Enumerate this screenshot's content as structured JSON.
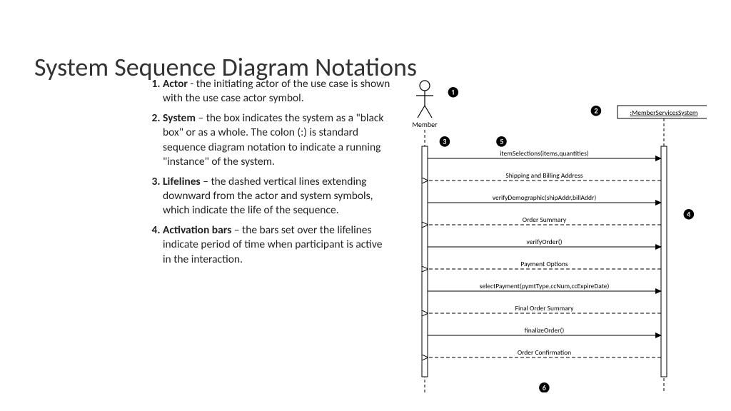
{
  "title": "System Sequence Diagram Notations",
  "list": [
    {
      "term": "Actor",
      "sep": " - ",
      "desc": "the initiating actor of the use case is shown with the use case actor symbol."
    },
    {
      "term": "System",
      "sep": " – ",
      "desc": "the box indicates the system as a \"black box\" or as a whole. The colon (:) is standard sequence diagram notation to indicate a running \"instance\" of the system."
    },
    {
      "term": "Lifelines",
      "sep": " – ",
      "desc": "the dashed vertical lines extending downward from the actor and system symbols, which indicate the life of the sequence."
    },
    {
      "term": "Activation bars",
      "sep": " – ",
      "desc": "the bars set over the lifelines indicate period of time when participant is active in the interaction."
    }
  ],
  "diagram": {
    "actorLabel": "Member",
    "systemLabel": ":MemberServicesSystem",
    "callouts": {
      "1": "❶",
      "2": "❷",
      "3": "❸",
      "4": "❹",
      "5": "❺",
      "6": "❻"
    },
    "messages": [
      {
        "text": "itemSelections(items,quantities)",
        "dir": "right",
        "dashed": false
      },
      {
        "text": "Shipping and Billing Address",
        "dir": "left",
        "dashed": true
      },
      {
        "text": "verifyDemographic(shipAddr,billAddr)",
        "dir": "right",
        "dashed": false
      },
      {
        "text": "Order Summary",
        "dir": "left",
        "dashed": true
      },
      {
        "text": "verifyOrder()",
        "dir": "right",
        "dashed": false
      },
      {
        "text": "Payment Options",
        "dir": "left",
        "dashed": true
      },
      {
        "text": "selectPayment(pymtType,ccNum,ccExpireDate)",
        "dir": "right",
        "dashed": false
      },
      {
        "text": "Final Order Summary",
        "dir": "left",
        "dashed": true
      },
      {
        "text": "finalizeOrder()",
        "dir": "right",
        "dashed": false
      },
      {
        "text": "Order Confirmation",
        "dir": "left",
        "dashed": true
      }
    ]
  }
}
